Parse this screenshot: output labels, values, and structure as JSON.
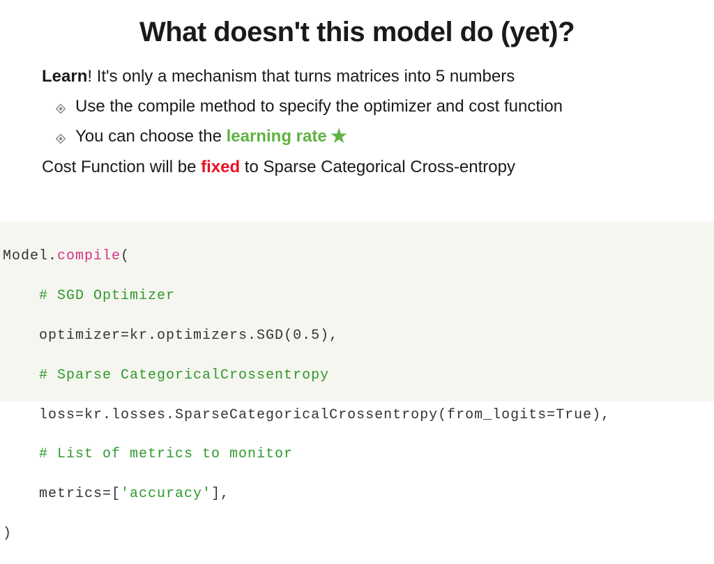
{
  "title": "What doesn't this model do (yet)?",
  "lines": {
    "l1_bold": "Learn",
    "l1_rest": "! It's only a mechanism that turns matrices into 5 numbers",
    "l2": "Use the compile method to specify the optimizer and cost function",
    "l3_a": "You can choose the ",
    "l3_green": "learning rate",
    "l4_a": "Cost Function will be ",
    "l4_red": "fixed",
    "l4_b": " to Sparse Categorical Cross-entropy"
  },
  "code": {
    "l1a": "Model.",
    "l1b": "compile",
    "l1c": "(",
    "l2": "    # SGD Optimizer",
    "l3": "    optimizer=kr.optimizers.SGD(0.5),",
    "l4": "    # Sparse CategoricalCrossentropy",
    "l5": "    loss=kr.losses.SparseCategoricalCrossentropy(from_logits=True),",
    "l6": "    # List of metrics to monitor",
    "l7a": "    metrics=[",
    "l7b": "'accuracy'",
    "l7c": "],",
    "l8": ")"
  }
}
